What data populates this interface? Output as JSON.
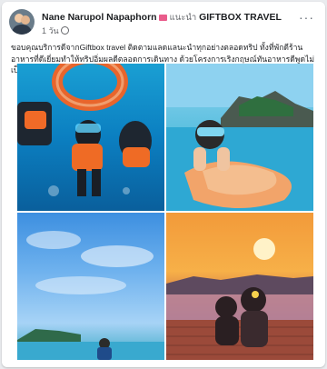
{
  "post": {
    "author": "Nane Narupol Napaphorn",
    "with_word": "แนะนำ",
    "partner": "GIFTBOX TRAVEL",
    "time": "1 วัน",
    "more_label": "···",
    "caption": "ขอบคุณบริการดีจากGiftbox travel ติดตามแลดแลนะนำทุกอย่างตลอดทริป ทั้งที่พักดีร้านอาหารที่ดีเยี่ยมทำให้ทริปอิ่มผลดีตลอดการเดินทาง ด้วยโครงการเริงกฤษณ์ทันอาหารดีพูดไม่เป็นไรไปลุ่ยน้ำกลับมาโปรแกรมอีกแน่นอน"
  },
  "colors": {
    "card_bg": "#ffffff",
    "page_bg": "#e9ebee",
    "text_primary": "#1c1e21",
    "text_secondary": "#65676b"
  },
  "photos": [
    {
      "subject": "snorkelers-underwater"
    },
    {
      "subject": "snorkeler-island"
    },
    {
      "subject": "beach-sky"
    },
    {
      "subject": "sunset-pier"
    }
  ]
}
